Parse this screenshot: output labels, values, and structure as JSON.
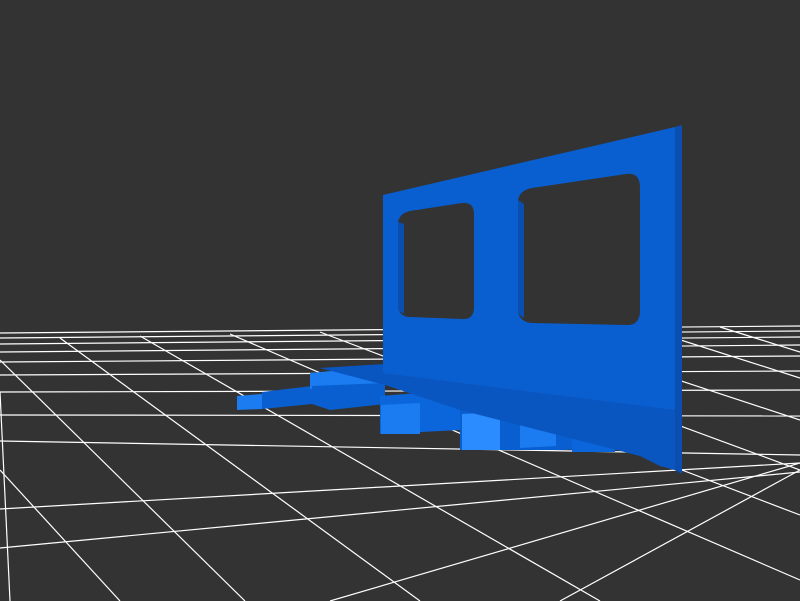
{
  "viewer": {
    "background_color": "#333333",
    "grid_color": "#ffffff",
    "model_color": "#0a5fd0",
    "model_highlight_color": "#1a7cf0",
    "model_shadow_color": "#0a4fb0"
  },
  "model": {
    "name": "",
    "panel_openings": 2,
    "base_fingers": true
  }
}
